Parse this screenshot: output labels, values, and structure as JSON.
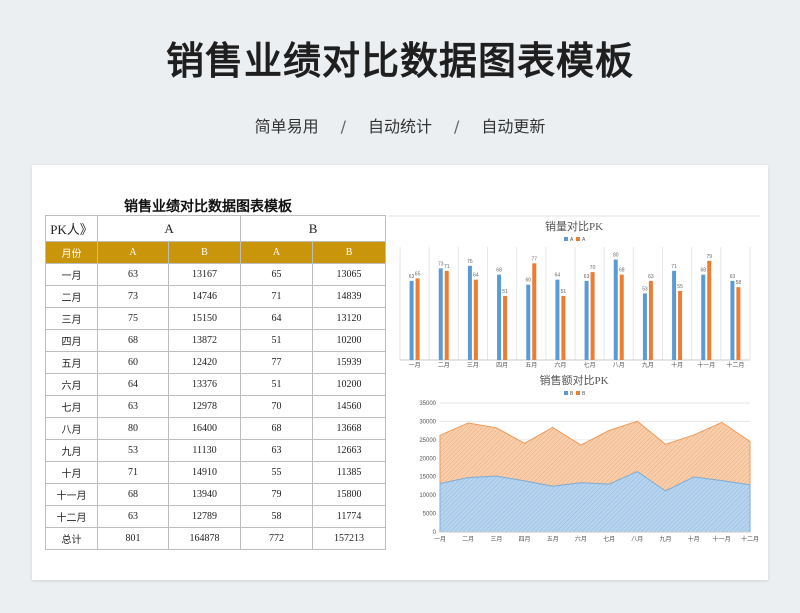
{
  "header": {
    "title": "销售业绩对比数据图表模板",
    "subtitle_items": [
      "简单易用",
      "自动统计",
      "自动更新"
    ],
    "separator": "/"
  },
  "sheet": {
    "title": "销售业绩对比数据图表模板",
    "head_row1": [
      "PK人》",
      "A",
      "B"
    ],
    "head_row2": [
      "月份",
      "A",
      "B",
      "A",
      "B"
    ],
    "rows": [
      [
        "一月",
        "63",
        "13167",
        "65",
        "13065"
      ],
      [
        "二月",
        "73",
        "14746",
        "71",
        "14839"
      ],
      [
        "三月",
        "75",
        "15150",
        "64",
        "13120"
      ],
      [
        "四月",
        "68",
        "13872",
        "51",
        "10200"
      ],
      [
        "五月",
        "60",
        "12420",
        "77",
        "15939"
      ],
      [
        "六月",
        "64",
        "13376",
        "51",
        "10200"
      ],
      [
        "七月",
        "63",
        "12978",
        "70",
        "14560"
      ],
      [
        "八月",
        "80",
        "16400",
        "68",
        "13668"
      ],
      [
        "九月",
        "53",
        "11130",
        "63",
        "12663"
      ],
      [
        "十月",
        "71",
        "14910",
        "55",
        "11385"
      ],
      [
        "十一月",
        "68",
        "13940",
        "79",
        "15800"
      ],
      [
        "十二月",
        "63",
        "12789",
        "58",
        "11774"
      ],
      [
        "总计",
        "801",
        "164878",
        "772",
        "157213"
      ]
    ],
    "header_color": "#c8950b"
  },
  "chart_data": [
    {
      "type": "bar",
      "title": "销量对比PK",
      "categories": [
        "一月",
        "二月",
        "三月",
        "四月",
        "五月",
        "六月",
        "七月",
        "八月",
        "九月",
        "十月",
        "十一月",
        "十二月"
      ],
      "series": [
        {
          "name": "A",
          "color": "#5b9bd5",
          "values": [
            63,
            73,
            75,
            68,
            60,
            64,
            63,
            80,
            53,
            71,
            68,
            63
          ]
        },
        {
          "name": "A",
          "color": "#ed7d31",
          "values": [
            65,
            71,
            64,
            51,
            77,
            51,
            70,
            68,
            63,
            55,
            79,
            58
          ]
        }
      ],
      "ylim": [
        0,
        90
      ],
      "grid": "vertical",
      "legend": "top",
      "data_labels": true
    },
    {
      "type": "area",
      "stacked": true,
      "title": "销售额对比PK",
      "categories": [
        "一月",
        "二月",
        "三月",
        "四月",
        "五月",
        "六月",
        "七月",
        "八月",
        "九月",
        "十月",
        "十一月",
        "十二月"
      ],
      "series": [
        {
          "name": "B",
          "color": "#5b9bd5",
          "values": [
            13167,
            14746,
            15150,
            13872,
            12420,
            13376,
            12978,
            16400,
            11130,
            14910,
            13940,
            12789
          ]
        },
        {
          "name": "B",
          "color": "#ed7d31",
          "values": [
            13065,
            14839,
            13120,
            10200,
            15939,
            10200,
            14560,
            13668,
            12663,
            11385,
            15800,
            11774
          ]
        }
      ],
      "yticks": [
        "0",
        "5000",
        "10000",
        "15000",
        "20000",
        "25000",
        "30000",
        "35000"
      ],
      "ylim": [
        0,
        35000
      ],
      "grid": "horizontal",
      "legend": "top"
    }
  ]
}
